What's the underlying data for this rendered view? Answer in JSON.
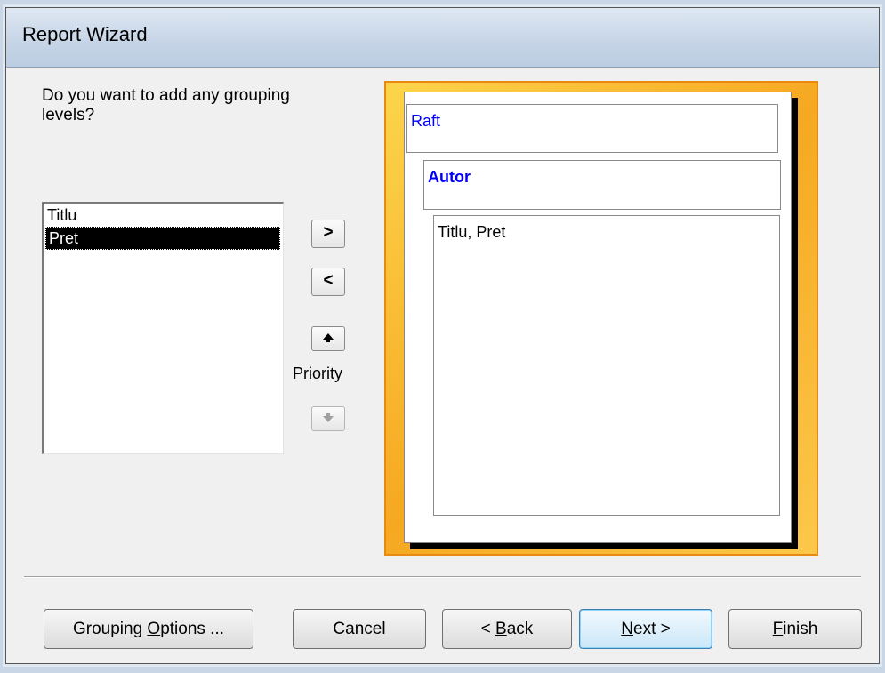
{
  "window": {
    "title": "Report Wizard"
  },
  "question": "Do you want to add any grouping levels?",
  "field_list": {
    "items": [
      "Titlu",
      "Pret"
    ],
    "selected": "Pret"
  },
  "mover_buttons": {
    "add": ">",
    "remove": "<"
  },
  "priority_label": "Priority",
  "preview": {
    "level1": "Raft",
    "level2": "Autor",
    "detail": "Titlu, Pret",
    "colors": {
      "group_text": "#0000ff",
      "frame": "#f7b42c"
    }
  },
  "buttons": {
    "grouping_options": {
      "pre": "Grouping ",
      "key": "O",
      "post": "ptions ..."
    },
    "cancel": {
      "label": "Cancel"
    },
    "back": {
      "pre": "< ",
      "key": "B",
      "post": "ack"
    },
    "next": {
      "pre": "",
      "key": "N",
      "post": "ext >"
    },
    "finish": {
      "pre": "",
      "key": "F",
      "post": "inish"
    }
  }
}
